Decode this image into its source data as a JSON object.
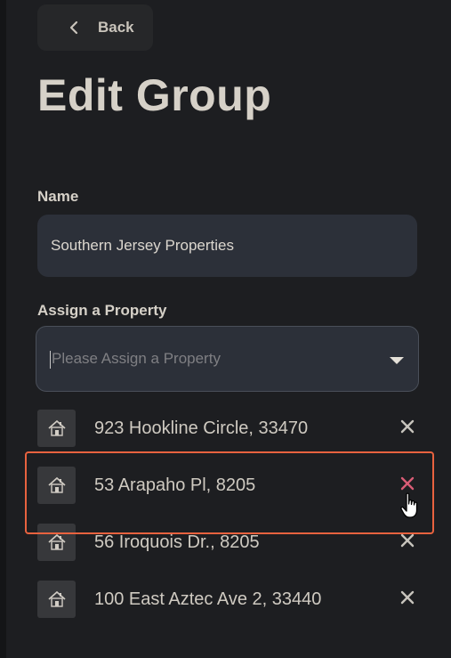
{
  "header": {
    "back_label": "Back",
    "title": "Edit Group"
  },
  "form": {
    "name_label": "Name",
    "name_value": "Southern Jersey Properties",
    "assign_label": "Assign a Property",
    "assign_placeholder": "Please Assign a Property"
  },
  "properties": [
    {
      "address": "923 Hookline Circle, 33470",
      "icon": "house-icon",
      "remove_icon": "close-icon"
    },
    {
      "address": "53 Arapaho Pl, 8205",
      "icon": "house-icon",
      "remove_icon": "close-icon",
      "hovered": true
    },
    {
      "address": "56 Iroquois Dr., 8205",
      "icon": "house-icon",
      "remove_icon": "close-icon"
    },
    {
      "address": "100 East Aztec Ave 2, 33440",
      "icon": "house-icon",
      "remove_icon": "close-icon"
    }
  ],
  "colors": {
    "background": "#1d1e21",
    "input_bg": "#2c3039",
    "remove_hover": "#d95d76",
    "remove_default": "#c7c4bd",
    "highlight": "#e8623f"
  }
}
